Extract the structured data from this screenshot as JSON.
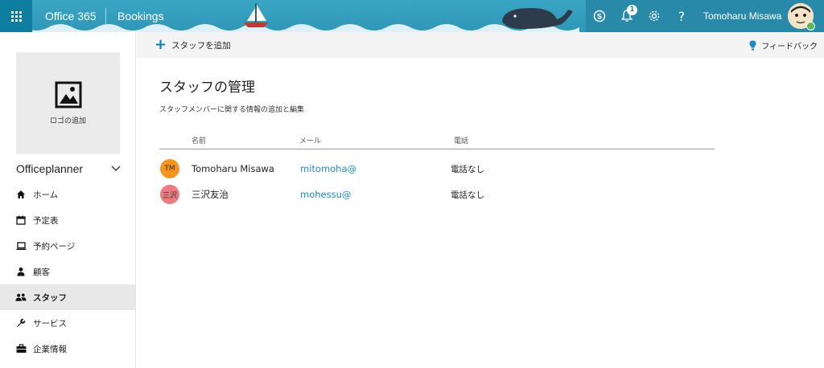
{
  "header": {
    "suite": "Office 365",
    "app": "Bookings",
    "notification_count": "1",
    "help": "?",
    "user_name": "Tomoharu Misawa"
  },
  "sidebar": {
    "logo_label": "ロゴの追加",
    "business_name": "Officeplanner",
    "items": [
      {
        "label": "ホーム",
        "icon": "home-icon",
        "active": false
      },
      {
        "label": "予定表",
        "icon": "calendar-icon",
        "active": false
      },
      {
        "label": "予約ページ",
        "icon": "laptop-icon",
        "active": false
      },
      {
        "label": "顧客",
        "icon": "person-icon",
        "active": false
      },
      {
        "label": "スタッフ",
        "icon": "people-icon",
        "active": true
      },
      {
        "label": "サービス",
        "icon": "wrench-icon",
        "active": false
      },
      {
        "label": "企業情報",
        "icon": "briefcase-icon",
        "active": false
      }
    ]
  },
  "command_bar": {
    "add_staff": "スタッフを追加",
    "feedback": "フィードバック"
  },
  "main": {
    "title": "スタッフの管理",
    "subtitle": "スタッフメンバーに関する情報の追加と編集",
    "columns": {
      "name": "名前",
      "mail": "メール",
      "phone": "電話"
    },
    "staff": [
      {
        "initials": "TM",
        "name": "Tomoharu Misawa",
        "mail": "mitomoha@",
        "phone": "電話なし",
        "color": "#f7941d"
      },
      {
        "initials": "三沢",
        "name": "三沢友治",
        "mail": "mohessu@",
        "phone": "電話なし",
        "color": "#ee7b7f"
      }
    ]
  },
  "colors": {
    "topbar": "#3aa5c4",
    "accent": "#0d7bbf",
    "link": "#1a8bbf"
  }
}
